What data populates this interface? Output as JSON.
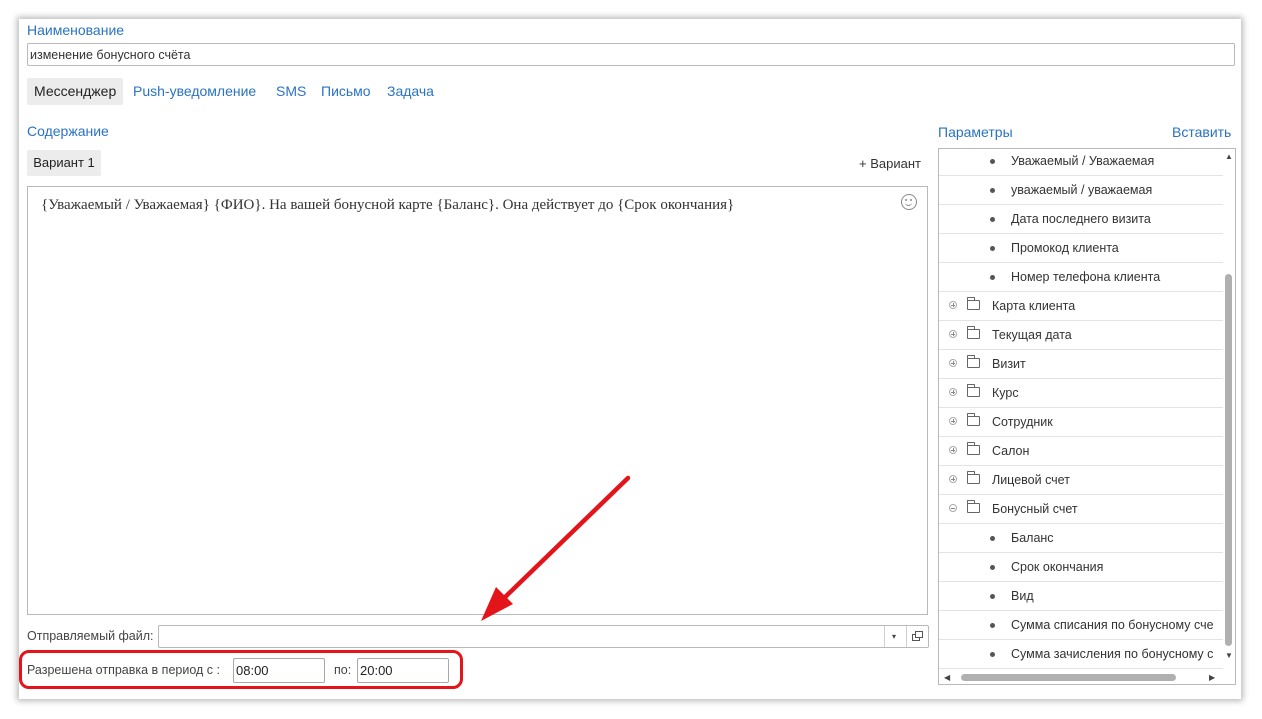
{
  "form": {
    "name_label": "Наименование",
    "name_value": "изменение бонусного счёта"
  },
  "channels": {
    "tabs": [
      "Мессенджер",
      "Push-уведомление",
      "SMS",
      "Письмо",
      "Задача"
    ],
    "active": "Мессенджер"
  },
  "content": {
    "label": "Содержание",
    "variant_tab": "Вариант 1",
    "add_variant": "+ Вариант",
    "text": "{Уважаемый / Уважаемая} {ФИО}. На вашей бонусной карте {Баланс}. Она действует до {Срок окончания}",
    "emoji_icon": "smiley-icon"
  },
  "file": {
    "label": "Отправляемый файл:",
    "value": ""
  },
  "schedule": {
    "label": "Разрешена отправка в период с :",
    "from": "08:00",
    "to_label": "по:",
    "to": "20:00"
  },
  "params": {
    "label": "Параметры",
    "insert": "Вставить",
    "items": [
      {
        "kind": "leaf",
        "label": "Уважаемый / Уважаемая"
      },
      {
        "kind": "leaf",
        "label": "уважаемый / уважаемая"
      },
      {
        "kind": "leaf",
        "label": "Дата последнего визита"
      },
      {
        "kind": "leaf",
        "label": "Промокод клиента"
      },
      {
        "kind": "leaf",
        "label": "Номер телефона клиента"
      },
      {
        "kind": "folder",
        "label": "Карта клиента",
        "expanded": false
      },
      {
        "kind": "folder",
        "label": "Текущая дата",
        "expanded": false
      },
      {
        "kind": "folder",
        "label": "Визит",
        "expanded": false
      },
      {
        "kind": "folder",
        "label": "Курс",
        "expanded": false
      },
      {
        "kind": "folder",
        "label": "Сотрудник",
        "expanded": false
      },
      {
        "kind": "folder",
        "label": "Салон",
        "expanded": false
      },
      {
        "kind": "folder",
        "label": "Лицевой счет",
        "expanded": false
      },
      {
        "kind": "folder",
        "label": "Бонусный счет",
        "expanded": true
      },
      {
        "kind": "leaf",
        "label": "Баланс"
      },
      {
        "kind": "leaf",
        "label": "Срок окончания"
      },
      {
        "kind": "leaf",
        "label": "Вид"
      },
      {
        "kind": "leaf",
        "label": "Сумма списания по бонусному сче"
      },
      {
        "kind": "leaf",
        "label": "Сумма зачисления по бонусному с"
      }
    ]
  },
  "colors": {
    "link": "#2a73c2",
    "highlight": "#e4141b"
  }
}
